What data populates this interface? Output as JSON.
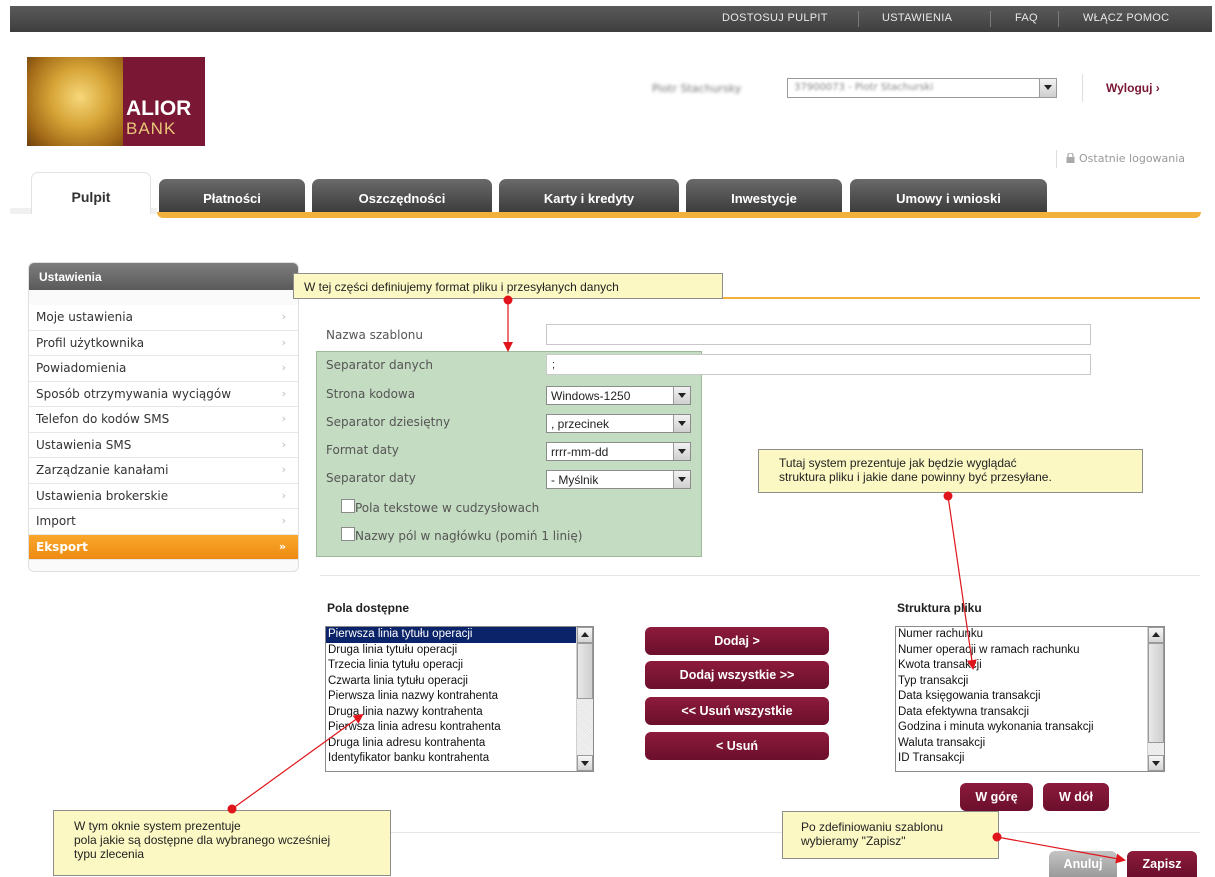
{
  "topnav": {
    "customize": "DOSTOSUJ PULPIT",
    "settings": "USTAWIENIA",
    "faq": "FAQ",
    "help": "WŁĄCZ POMOC"
  },
  "logo": {
    "line1": "ALIOR",
    "line2": "BANK"
  },
  "user": {
    "name": "Piotr Stachursky",
    "account": "37900073 - Piotr Stachurski",
    "logout": "Wyloguj ›",
    "last_login": "Ostatnie logowania"
  },
  "tabs": [
    "Pulpit",
    "Płatności",
    "Oszczędności",
    "Karty i kredyty",
    "Inwestycje",
    "Umowy i wnioski"
  ],
  "sidebar": {
    "title": "Ustawienia",
    "items": [
      "Moje ustawienia",
      "Profil użytkownika",
      "Powiadomienia",
      "Sposób otrzymywania wyciągów",
      "Telefon do kodów SMS",
      "Ustawienia SMS",
      "Zarządzanie kanałami",
      "Ustawienia brokerskie",
      "Import",
      "Eksport"
    ],
    "arrow": "›",
    "active_arrow": "»"
  },
  "form": {
    "template_name_label": "Nazwa szablonu",
    "template_name_value": "",
    "data_separator_label": "Separator danych",
    "data_separator_value": ";",
    "codepage_label": "Strona kodowa",
    "codepage_value": "Windows-1250",
    "decimal_separator_label": "Separator dziesiętny",
    "decimal_separator_value": ", przecinek",
    "date_format_label": "Format daty",
    "date_format_value": "rrrr-mm-dd",
    "date_separator_label": "Separator daty",
    "date_separator_value": "- Myślnik",
    "quoted_fields_label": "Pola tekstowe w cudzysłowach",
    "header_names_label": "Nazwy pól w nagłówku (pomiń 1 linię)"
  },
  "available_fields": {
    "title": "Pola dostępne",
    "items": [
      "Pierwsza linia tytułu operacji",
      "Druga linia tytułu operacji",
      "Trzecia linia tytułu operacji",
      "Czwarta linia tytułu operacji",
      "Pierwsza linia nazwy kontrahenta",
      "Druga linia nazwy kontrahenta",
      "Pierwsza linia adresu kontrahenta",
      "Druga linia adresu kontrahenta",
      "Identyfikator banku kontrahenta"
    ]
  },
  "file_structure": {
    "title": "Struktura pliku",
    "items": [
      "Numer rachunku",
      "Numer operacji w ramach rachunku",
      "Kwota transakcji",
      "Typ transakcji",
      "Data księgowania transakcji",
      "Data efektywna transakcji",
      "Godzina i minuta wykonania transakcji",
      "Waluta transakcji",
      "ID Transakcji"
    ]
  },
  "buttons": {
    "add": "Dodaj >",
    "add_all": "Dodaj wszystkie >>",
    "remove_all": "<< Usuń wszystkie",
    "remove": "< Usuń",
    "up": "W górę",
    "down": "W dół",
    "cancel": "Anuluj",
    "save": "Zapisz"
  },
  "callouts": {
    "format": "W tej części definiujemy format pliku i przesyłanych danych",
    "structure": "Tutaj system prezentuje jak będzie wyglądać\nstruktura pliku i jakie dane powinny być przesyłane.",
    "fields": "W tym oknie system prezentuje\npola jakie są dostępne dla wybranego wcześniej\ntypu zlecenia",
    "save": "Po zdefiniowaniu szablonu\nwybieramy \"Zapisz\""
  },
  "colors": {
    "brand": "#7a1734",
    "accent": "#f2b13c",
    "active": "#f39418",
    "callout_bg": "#fcf8c4",
    "panel_bg": "#c4dcc1",
    "annotation": "#e0141b"
  }
}
